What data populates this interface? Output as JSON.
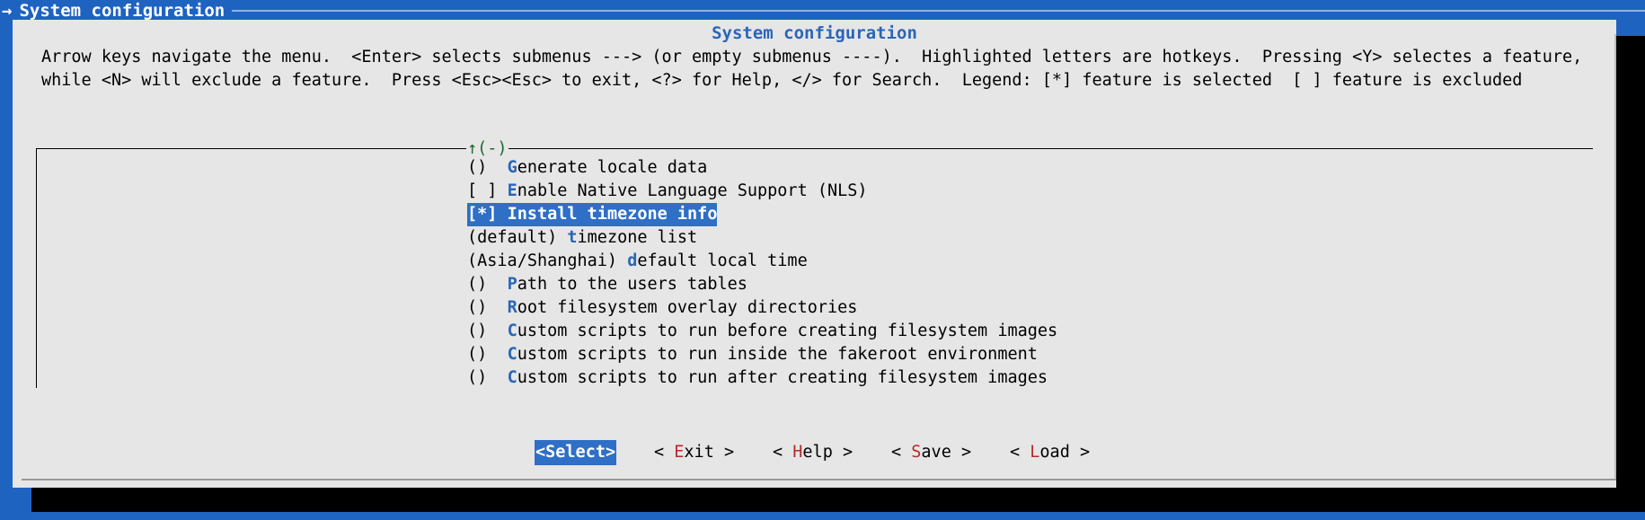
{
  "window": {
    "arrow": "→",
    "title": "System configuration"
  },
  "dialog": {
    "title": "System configuration",
    "help_line_1": "Arrow keys navigate the menu.  <Enter> selects submenus ---> (or empty submenus ----).  Highlighted letters are hotkeys.  Pressing <Y> selectes a feature,",
    "help_line_2": "while <N> will exclude a feature.  Press <Esc><Esc> to exit, <?> for Help, </> for Search.  Legend: [*] feature is selected  [ ] feature is excluded",
    "scroll_indicator": "↑(-)"
  },
  "menu": {
    "items": [
      {
        "prefix": "()  ",
        "hotkey": "G",
        "rest": "enerate locale data"
      },
      {
        "prefix": "[ ] ",
        "hotkey": "E",
        "rest": "nable Native Language Support (NLS)"
      },
      {
        "prefix": "[*] ",
        "hotkey": "I",
        "rest": "nstall timezone info"
      },
      {
        "prefix": "(default) ",
        "hotkey": "t",
        "rest": "imezone list"
      },
      {
        "prefix": "(Asia/Shanghai) ",
        "hotkey": "d",
        "rest": "efault local time"
      },
      {
        "prefix": "()  ",
        "hotkey": "P",
        "rest": "ath to the users tables"
      },
      {
        "prefix": "()  ",
        "hotkey": "R",
        "rest": "oot filesystem overlay directories"
      },
      {
        "prefix": "()  ",
        "hotkey": "C",
        "rest": "ustom scripts to run before creating filesystem images"
      },
      {
        "prefix": "()  ",
        "hotkey": "C",
        "rest": "ustom scripts to run inside the fakeroot environment"
      },
      {
        "prefix": "()  ",
        "hotkey": "C",
        "rest": "ustom scripts to run after creating filesystem images"
      }
    ],
    "selected_index": 2
  },
  "buttons": {
    "select": {
      "left": "<",
      "hotkey": "S",
      "rest": "elect",
      "right": ">"
    },
    "exit": {
      "left": "< ",
      "hotkey": "E",
      "rest": "xit",
      "right": " >"
    },
    "help": {
      "left": "< ",
      "hotkey": "H",
      "rest": "elp",
      "right": " >"
    },
    "save": {
      "left": "< ",
      "hotkey": "S",
      "rest": "ave",
      "right": " >"
    },
    "load": {
      "left": "< ",
      "hotkey": "L",
      "rest": "oad",
      "right": " >"
    }
  },
  "colors": {
    "background": "#1f63c1",
    "dialog": "#e6e6e6",
    "accent": "#2f6fc5",
    "hotkey": "#2a66b6",
    "button_hotkey": "#b52a2a",
    "scroll_indicator": "#1d6b2c"
  }
}
